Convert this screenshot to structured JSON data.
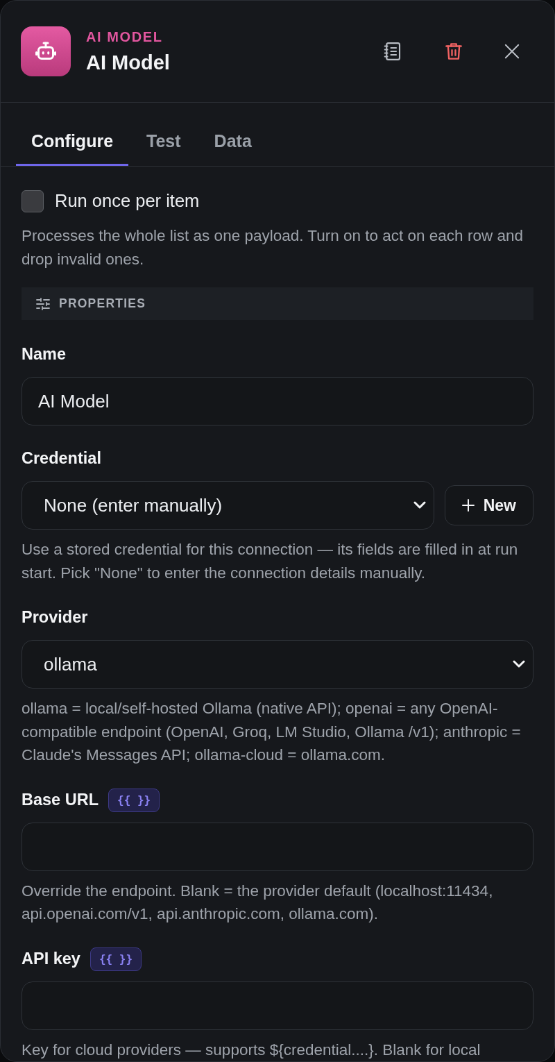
{
  "header": {
    "type_label": "AI MODEL",
    "title": "AI Model"
  },
  "tabs": [
    {
      "label": "Configure",
      "selected": true
    },
    {
      "label": "Test",
      "selected": false
    },
    {
      "label": "Data",
      "selected": false
    }
  ],
  "run_once": {
    "label": "Run once per item",
    "checked": false,
    "help": "Processes the whole list as one payload. Turn on to act on each row and drop invalid ones."
  },
  "section": {
    "title": "PROPERTIES"
  },
  "fields": [
    {
      "kind": "text",
      "label": "Name",
      "value": "AI Model"
    },
    {
      "kind": "select",
      "label": "Credential",
      "value": "None (enter manually)",
      "button": "New",
      "help": "Use a stored credential for this connection — its fields are filled in at run start. Pick \"None\" to enter the connection details manually."
    },
    {
      "kind": "select",
      "label": "Provider",
      "value": "ollama",
      "help": "ollama = local/self-hosted Ollama (native API); openai = any OpenAI-compatible endpoint (OpenAI, Groq, LM Studio, Ollama /v1); anthropic = Claude's Messages API; ollama-cloud = ollama.com."
    },
    {
      "kind": "text",
      "label": "Base URL",
      "badge": "{{ }}",
      "help": "Override the endpoint. Blank = the provider default (localhost:11434, api.openai.com/v1, api.anthropic.com, ollama.com)."
    },
    {
      "kind": "text",
      "label": "API key",
      "badge": "{{ }}",
      "help": "Key for cloud providers — supports ${credential....}. Blank for local"
    }
  ]
}
